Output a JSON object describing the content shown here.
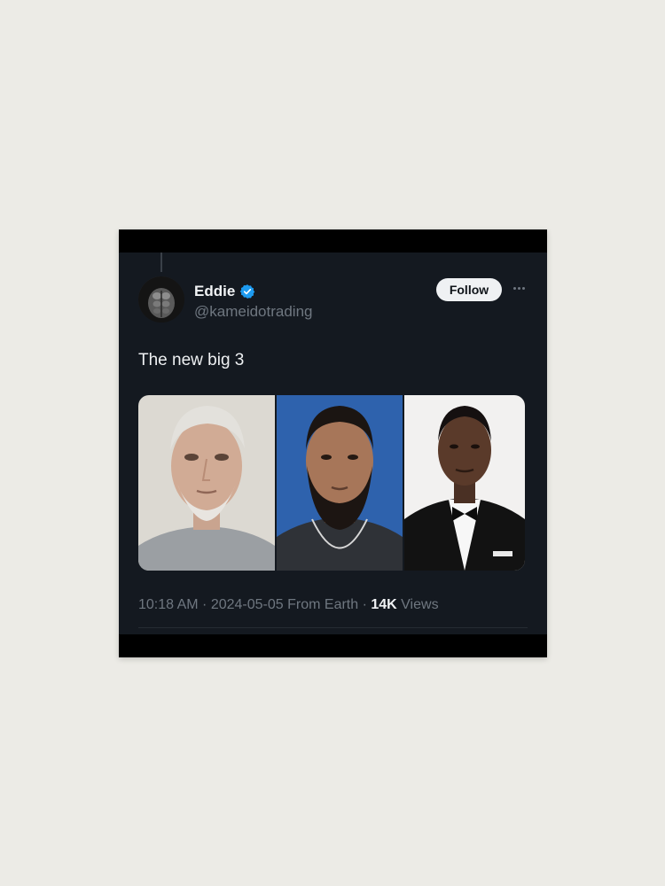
{
  "tweet": {
    "author_name": "Eddie",
    "handle": "@kameidotrading",
    "follow_label": "Follow",
    "text": "The new big 3",
    "time": "10:18 AM",
    "date": "2024-05-05",
    "location": "From Earth",
    "views_count": "14K",
    "views_label": "Views",
    "sep": " · "
  },
  "icons": {
    "verified": "verified-badge-icon",
    "more": "more-dots-icon"
  },
  "colors": {
    "card_bg": "#141920",
    "verified_blue": "#1d9bf0",
    "follow_bg": "#eff1f3",
    "muted_text": "#6f7780"
  }
}
